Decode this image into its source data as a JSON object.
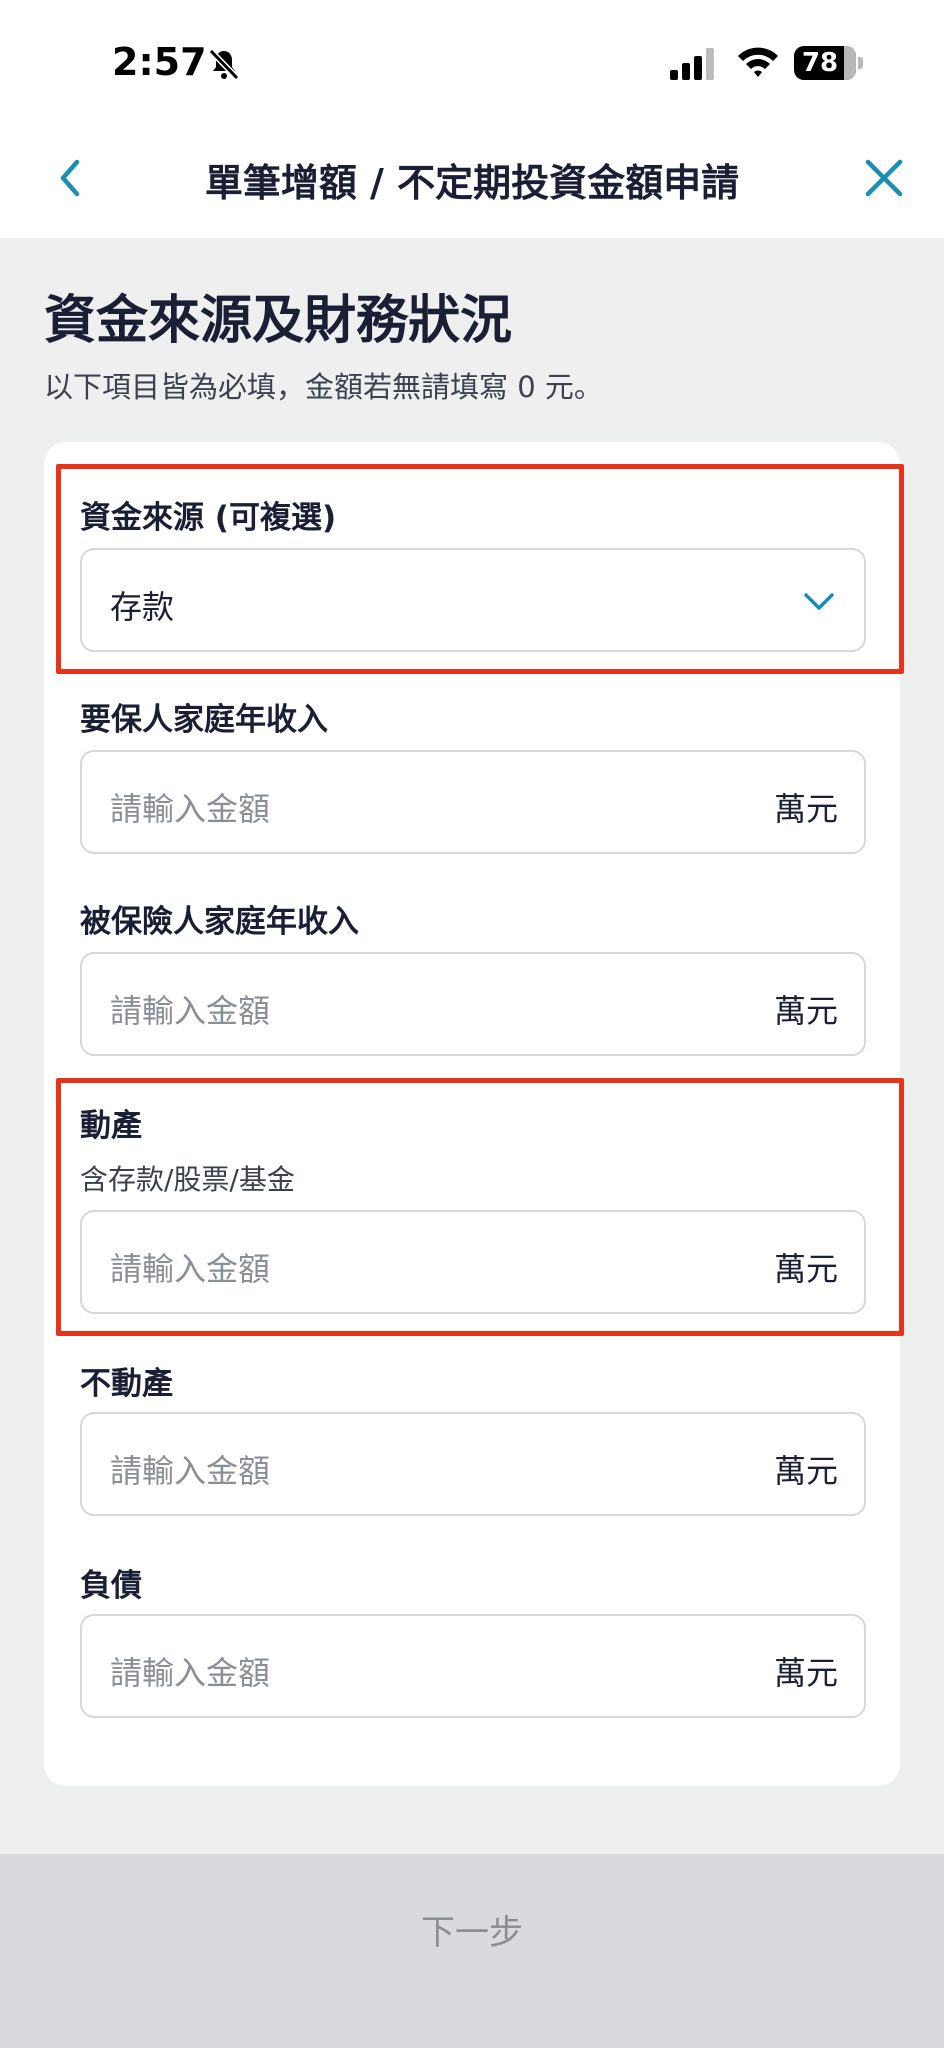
{
  "status_bar": {
    "time": "2:57",
    "battery": "78"
  },
  "header": {
    "title": "單筆增額 / 不定期投資金額申請"
  },
  "section": {
    "title": "資金來源及財務狀況",
    "subtitle": "以下項目皆為必填，金額若無請填寫 0 元。"
  },
  "fields": [
    {
      "label": "資金來源 (可複選)",
      "value": "存款"
    },
    {
      "label": "要保人家庭年收入",
      "placeholder": "請輸入金額",
      "unit": "萬元"
    },
    {
      "label": "被保險人家庭年收入",
      "placeholder": "請輸入金額",
      "unit": "萬元"
    },
    {
      "label": "動產",
      "hint": "含存款/股票/基金",
      "placeholder": "請輸入金額",
      "unit": "萬元"
    },
    {
      "label": "不動產",
      "placeholder": "請輸入金額",
      "unit": "萬元"
    },
    {
      "label": "負債",
      "placeholder": "請輸入金額",
      "unit": "萬元"
    }
  ],
  "footer": {
    "next_label": "下一步"
  },
  "colors": {
    "accent": "#1a8fb5",
    "highlight": "#e8321c",
    "text": "#1a1f36"
  }
}
